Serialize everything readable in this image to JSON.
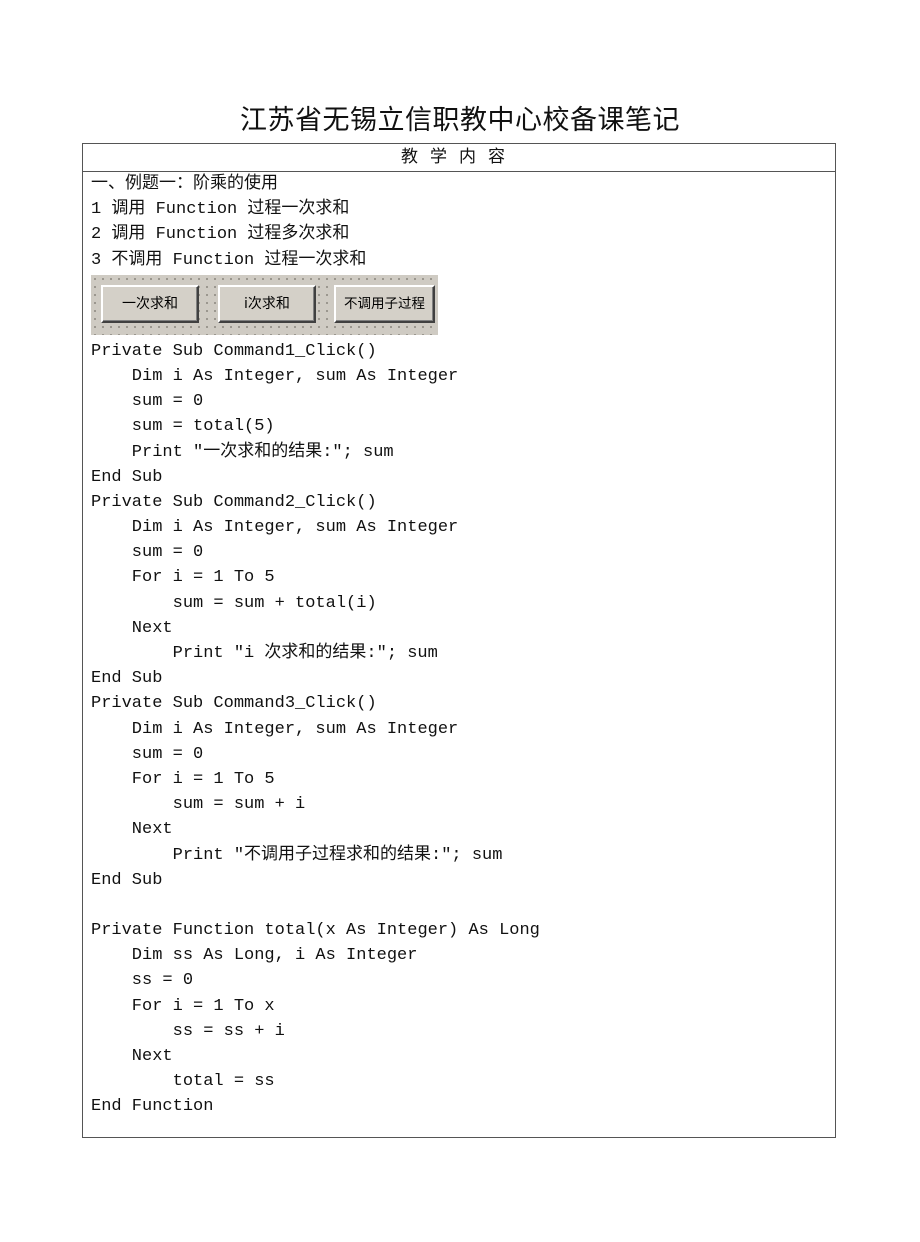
{
  "document": {
    "title": "江苏省无锡立信职教中心校备课笔记",
    "section_header": "教学内容"
  },
  "intro": {
    "lines": [
      "一、例题一：阶乘的使用",
      "1 调用 Function 过程一次求和",
      "2 调用 Function 过程多次求和",
      "3 不调用 Function 过程一次求和"
    ]
  },
  "form_buttons": [
    {
      "label": "一次求和"
    },
    {
      "label": "i次求和"
    },
    {
      "label": "不调用子过程"
    }
  ],
  "code": {
    "lines": [
      "Private Sub Command1_Click()",
      "    Dim i As Integer, sum As Integer",
      "    sum = 0",
      "    sum = total(5)",
      "    Print \"一次求和的结果:\"; sum",
      "End Sub",
      "Private Sub Command2_Click()",
      "    Dim i As Integer, sum As Integer",
      "    sum = 0",
      "    For i = 1 To 5",
      "        sum = sum + total(i)",
      "    Next",
      "        Print \"i 次求和的结果:\"; sum",
      "End Sub",
      "Private Sub Command3_Click()",
      "    Dim i As Integer, sum As Integer",
      "    sum = 0",
      "    For i = 1 To 5",
      "        sum = sum + i",
      "    Next",
      "        Print \"不调用子过程求和的结果:\"; sum",
      "End Sub",
      "",
      "Private Function total(x As Integer) As Long",
      "    Dim ss As Long, i As Integer",
      "    ss = 0",
      "    For i = 1 To x",
      "        ss = ss + i",
      "    Next",
      "        total = ss",
      "End Function"
    ]
  }
}
